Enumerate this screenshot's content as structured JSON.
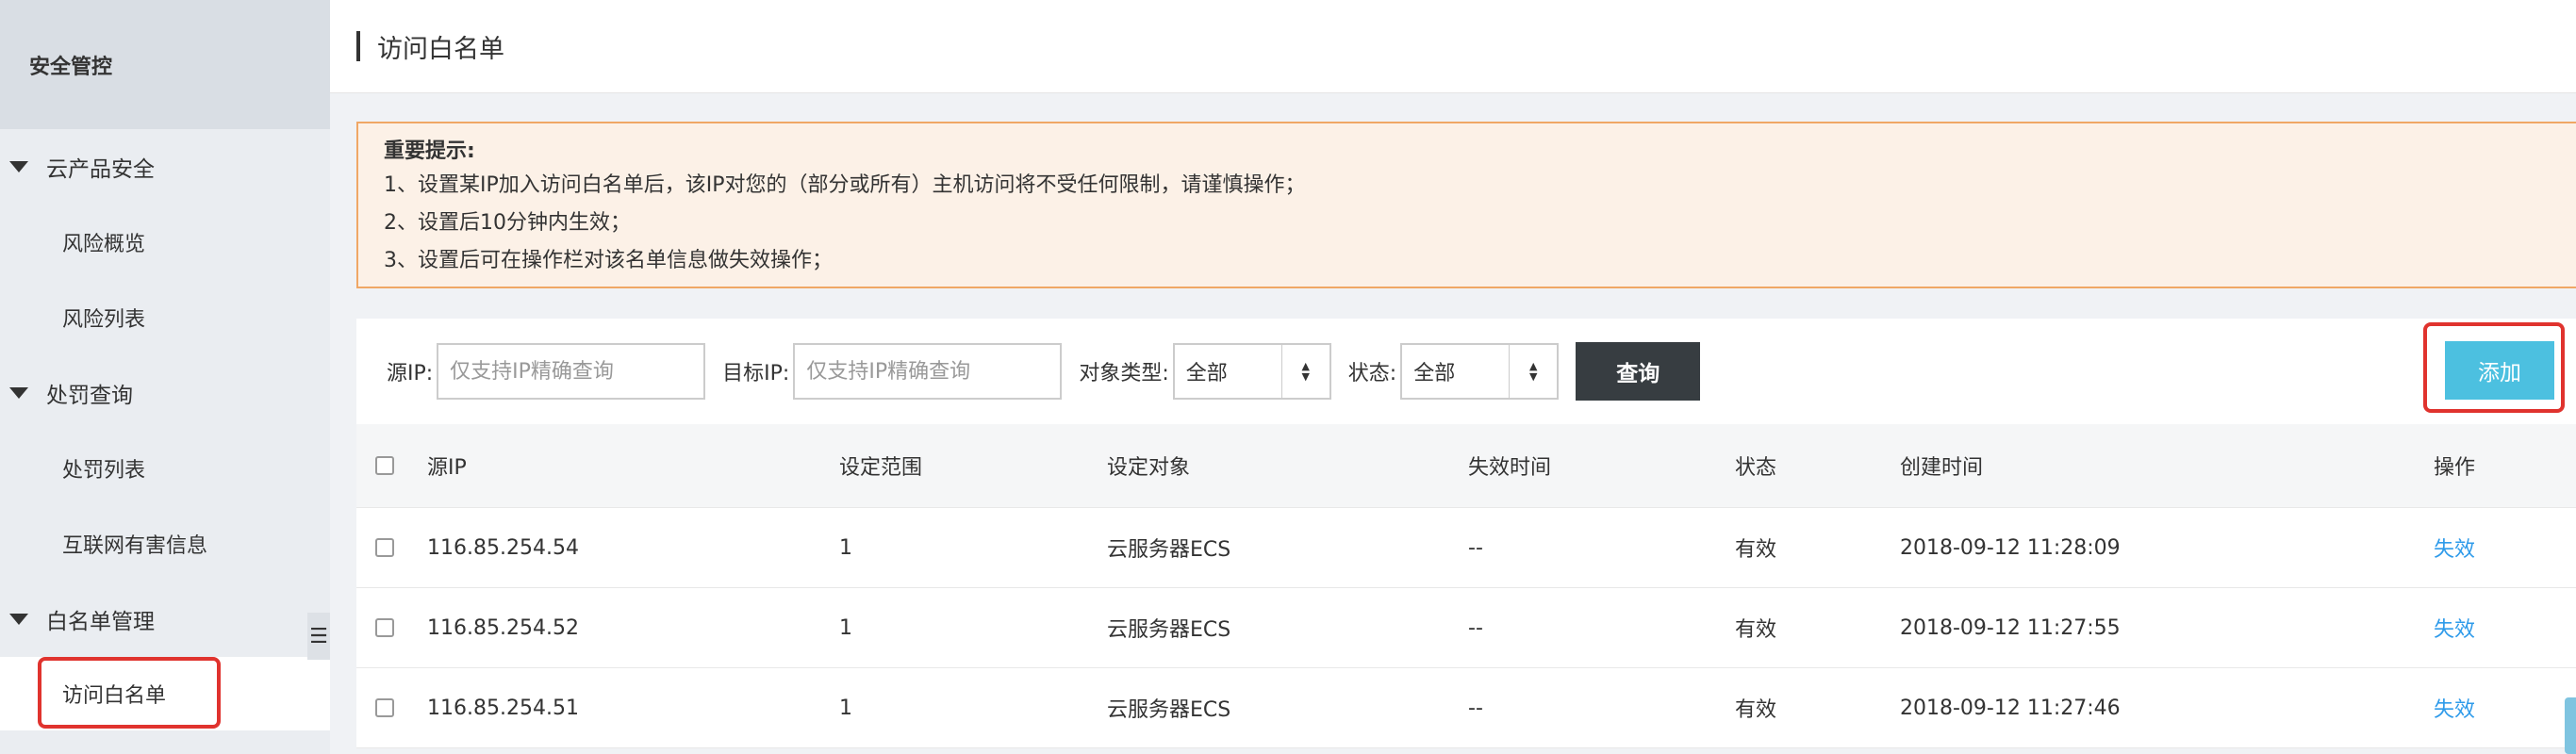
{
  "sidebar": {
    "header": "安全管控",
    "groups": [
      {
        "label": "云产品安全",
        "items": [
          "风险概览",
          "风险列表"
        ]
      },
      {
        "label": "处罚查询",
        "items": [
          "处罚列表",
          "互联网有害信息"
        ]
      },
      {
        "label": "白名单管理",
        "items": [
          "访问白名单"
        ]
      }
    ]
  },
  "page": {
    "title": "访问白名单"
  },
  "notice": {
    "title": "重要提示:",
    "lines": [
      "1、设置某IP加入访问白名单后，该IP对您的（部分或所有）主机访问将不受任何限制，请谨慎操作；",
      "2、设置后10分钟内生效；",
      "3、设置后可在操作栏对该名单信息做失效操作；"
    ]
  },
  "filters": {
    "source_ip_label": "源IP:",
    "source_ip_placeholder": "仅支持IP精确查询",
    "target_ip_label": "目标IP:",
    "target_ip_placeholder": "仅支持IP精确查询",
    "object_type_label": "对象类型:",
    "object_type_value": "全部",
    "status_label": "状态:",
    "status_value": "全部",
    "query_button": "查询",
    "add_button": "添加"
  },
  "table": {
    "headers": [
      "源IP",
      "设定范围",
      "设定对象",
      "失效时间",
      "状态",
      "创建时间",
      "操作"
    ],
    "rows": [
      {
        "ip": "116.85.254.54",
        "range": "1",
        "object": "云服务器ECS",
        "expire": "--",
        "status": "有效",
        "created": "2018-09-12 11:28:09",
        "action": "失效"
      },
      {
        "ip": "116.85.254.52",
        "range": "1",
        "object": "云服务器ECS",
        "expire": "--",
        "status": "有效",
        "created": "2018-09-12 11:27:55",
        "action": "失效"
      },
      {
        "ip": "116.85.254.51",
        "range": "1",
        "object": "云服务器ECS",
        "expire": "--",
        "status": "有效",
        "created": "2018-09-12 11:27:46",
        "action": "失效"
      }
    ]
  },
  "colors": {
    "accent": "#4cc0e0",
    "link": "#2f9bea",
    "highlight": "#e0332e",
    "notice_border": "#f0a765"
  }
}
